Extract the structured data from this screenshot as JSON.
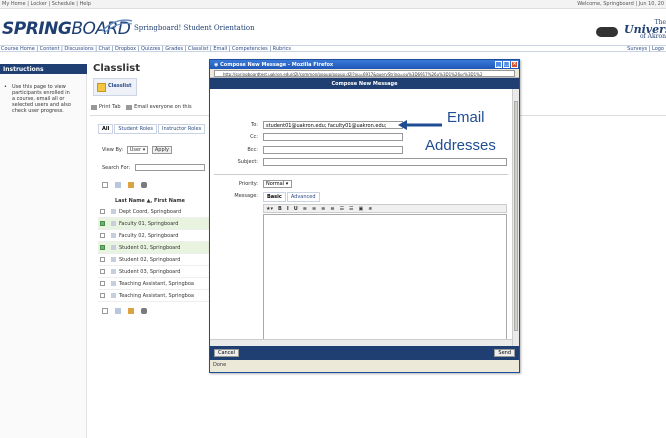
{
  "topbar": {
    "left": "My Home | Locker | Schedule | Help",
    "right": "Welcome, Springboard | Jun 10, 20"
  },
  "header": {
    "logo_bold": "SPRING",
    "logo_thin": "BOARD",
    "site_title": "Springboard! Student Orientation",
    "uni_line1": "The",
    "uni_line2": "University",
    "uni_line3": "of Akron"
  },
  "navbar": {
    "left": "Course Home | Content | Discussions | Chat | Dropbox | Quizzes | Grades | Classlist | Email | Competencies | Rubrics",
    "right": "Surveys | Logo"
  },
  "instructions": {
    "title": "Instructions",
    "text": "Use this page to view participants enrolled in a course, email all or selected users and also check user progress."
  },
  "classlist": {
    "title": "Classlist",
    "tab_label": "Classlist",
    "print_tab": "Print Tab",
    "email_everyone": "Email everyone on this",
    "tabs": [
      "All",
      "Student Roles",
      "Instructor Roles"
    ],
    "view_by_label": "View By:",
    "view_by_value": "User",
    "apply": "Apply",
    "search_for": "Search For:",
    "column_header": "Last Name ▲, First Name",
    "rows": [
      {
        "name": "Dept Coord, Springboard",
        "checked": false
      },
      {
        "name": "Faculty 01, Springboard",
        "checked": true
      },
      {
        "name": "Faculty 02, Springboard",
        "checked": false
      },
      {
        "name": "Student 01, Springboard",
        "checked": true
      },
      {
        "name": "Student 02, Springboard",
        "checked": false
      },
      {
        "name": "Student 03, Springboard",
        "checked": false
      },
      {
        "name": "Teaching Assistant, Springboa",
        "checked": false
      },
      {
        "name": "Teaching Assistant, Springboa",
        "checked": false
      }
    ]
  },
  "popup": {
    "window_title": "Compose New Message - Mozilla Firefox",
    "url": "http://springboardtest.uakron.edu/d2l/common/popup/popup.d2l?ou=6917&queryString=ou%3D6917%26u%3D1%26ur%3D1%2",
    "dialog_title": "Compose New Message",
    "to_label": "To:",
    "to_value": "student01@uakron.edu; faculty01@uakron.edu;",
    "cc_label": "Cc:",
    "bcc_label": "Bcc:",
    "subject_label": "Subject:",
    "priority_label": "Priority:",
    "priority_value": "Normal",
    "message_label": "Message:",
    "editor_tabs": [
      "Basic",
      "Advanced"
    ],
    "editor_tools": [
      "★▾",
      "B",
      "I",
      "U",
      "≡",
      "≡",
      "≡",
      "≡",
      "☰",
      "☰",
      "▣",
      "≉"
    ],
    "cancel": "Cancel",
    "send": "Send",
    "status": "Done"
  },
  "annotation": {
    "line1": "Email",
    "line2": "Addresses"
  },
  "colors": {
    "brand_navy": "#1f3f72",
    "title_blue": "#1d56b6",
    "annotation_blue": "#1f4d94"
  }
}
